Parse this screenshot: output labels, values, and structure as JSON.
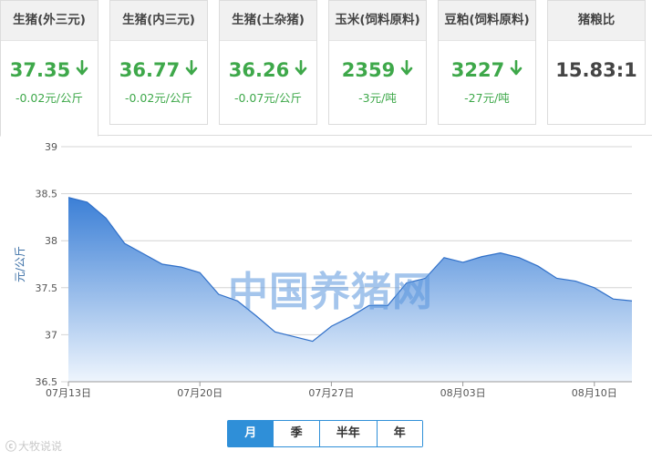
{
  "cards": [
    {
      "title": "生猪(外三元)",
      "price": "37.35",
      "change": "-0.02元/公斤",
      "direction": "down"
    },
    {
      "title": "生猪(内三元)",
      "price": "36.77",
      "change": "-0.02元/公斤",
      "direction": "down"
    },
    {
      "title": "生猪(土杂猪)",
      "price": "36.26",
      "change": "-0.07元/公斤",
      "direction": "down"
    },
    {
      "title": "玉米(饲料原料)",
      "price": "2359",
      "change": "-3元/吨",
      "direction": "down"
    },
    {
      "title": "豆粕(饲料原料)",
      "price": "3227",
      "change": "-27元/吨",
      "direction": "down"
    },
    {
      "title": "猪粮比",
      "price": "15.83:1",
      "change": "",
      "direction": "none"
    }
  ],
  "colors": {
    "down": "#3ea84a",
    "line": "#2f6fc8",
    "area_top": "#3b7fd6",
    "area_bottom": "#eef5fd",
    "grid": "#d4d4d4",
    "tab_active": "#2f8fd8"
  },
  "watermark": "中国养猪网",
  "range_tabs": [
    "月",
    "季",
    "半年",
    "年"
  ],
  "brand": {
    "logo": "ⓒ",
    "text": "大牧说说"
  },
  "chart_data": {
    "type": "area",
    "ylabel": "元/公斤",
    "ylim": [
      36.5,
      39
    ],
    "yticks": [
      "36.5",
      "37",
      "37.5",
      "38",
      "38.5",
      "39"
    ],
    "xticks": [
      {
        "label": "07月13日",
        "index": 0
      },
      {
        "label": "07月20日",
        "index": 7
      },
      {
        "label": "07月27日",
        "index": 14
      },
      {
        "label": "08月03日",
        "index": 21
      },
      {
        "label": "08月10日",
        "index": 28
      }
    ],
    "values": [
      38.46,
      38.41,
      38.24,
      37.97,
      37.86,
      37.75,
      37.72,
      37.66,
      37.43,
      37.36,
      37.2,
      37.03,
      36.98,
      36.93,
      37.09,
      37.19,
      37.31,
      37.31,
      37.55,
      37.6,
      37.82,
      37.77,
      37.83,
      37.87,
      37.82,
      37.73,
      37.6,
      37.57,
      37.5,
      37.38,
      37.36
    ],
    "grid": true
  }
}
